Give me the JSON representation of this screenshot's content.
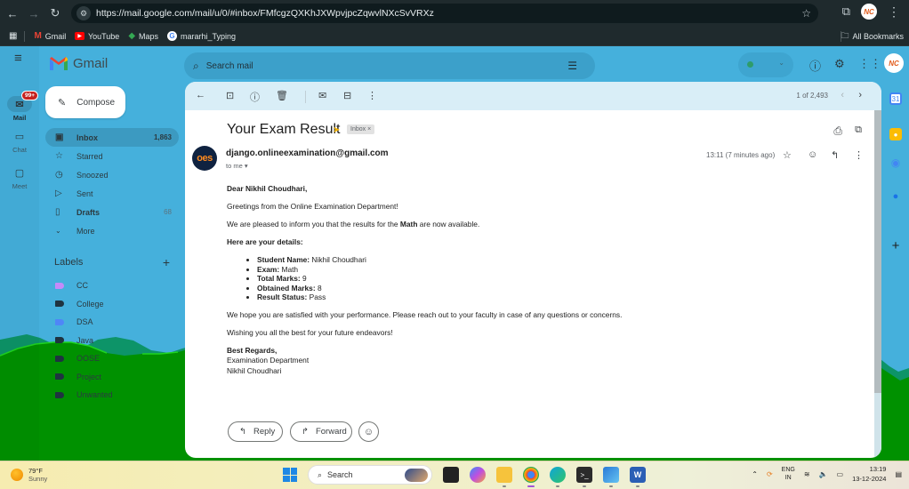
{
  "browser": {
    "url": "https://mail.google.com/mail/u/0/#inbox/FMfcgzQXKhJXWpvjpcZqwvlNXcSvVRXz",
    "bookmarks": [
      {
        "label": "Gmail",
        "icon": "gmail-icon"
      },
      {
        "label": "YouTube",
        "icon": "youtube-icon"
      },
      {
        "label": "Maps",
        "icon": "maps-icon"
      },
      {
        "label": "mararhi_Typing",
        "icon": "google-icon"
      }
    ],
    "all_bookmarks": "All Bookmarks",
    "profile_initials": "NC"
  },
  "gmail": {
    "app_name": "Gmail",
    "rail": [
      {
        "label": "Mail",
        "badge": "99+",
        "active": true
      },
      {
        "label": "Chat"
      },
      {
        "label": "Meet"
      }
    ],
    "compose": "Compose",
    "folders": [
      {
        "label": "Inbox",
        "count": "1,863",
        "icon": "inbox-icon",
        "active": true
      },
      {
        "label": "Starred",
        "count": "",
        "icon": "star-icon"
      },
      {
        "label": "Snoozed",
        "count": "",
        "icon": "clock-icon"
      },
      {
        "label": "Sent",
        "count": "",
        "icon": "send-icon"
      },
      {
        "label": "Drafts",
        "count": "68",
        "icon": "draft-icon"
      },
      {
        "label": "More",
        "count": "",
        "icon": "chevron-down-icon"
      }
    ],
    "labels_title": "Labels",
    "labels": [
      {
        "name": "CC",
        "color": "#c58af9"
      },
      {
        "name": "College",
        "color": "#1f3340"
      },
      {
        "name": "DSA",
        "color": "#4f86f7"
      },
      {
        "name": "Java",
        "color": "#1f3340"
      },
      {
        "name": "OOSE",
        "color": "#1f3340"
      },
      {
        "name": "Project",
        "color": "#1f3340"
      },
      {
        "name": "Unwanted",
        "color": "#1f3340"
      }
    ],
    "search_placeholder": "Search mail",
    "pager": "1 of 2,493"
  },
  "email": {
    "subject": "Your Exam Result",
    "chip": "Inbox ×",
    "sender": "django.onlineexamination@gmail.com",
    "avatar_text": "oes",
    "to": "to me ▾",
    "time": "13:11 (7 minutes ago)",
    "greeting": "Dear Nikhil Choudhari,",
    "p1": "Greetings from the Online Examination Department!",
    "p2_pre": "We are pleased to inform you that the results for the ",
    "p2_bold": "Math",
    "p2_post": " are now available.",
    "details_heading": "Here are your details:",
    "details": [
      {
        "key": "Student Name:",
        "value": " Nikhil Choudhari"
      },
      {
        "key": "Exam:",
        "value": " Math"
      },
      {
        "key": "Total Marks:",
        "value": " 9"
      },
      {
        "key": "Obtained Marks:",
        "value": " 8"
      },
      {
        "key": "Result Status:",
        "value": " Pass"
      }
    ],
    "p3": "We hope you are satisfied with your performance. Please reach out to your faculty in case of any questions or concerns.",
    "p4": "Wishing you all the best for your future endeavors!",
    "sign_off": "Best Regards,",
    "sig_line1": "Examination Department",
    "sig_line2": "Nikhil Choudhari",
    "reply": "Reply",
    "forward": "Forward"
  },
  "taskbar": {
    "temp": "79°F",
    "weather": "Sunny",
    "search": "Search",
    "lang1": "ENG",
    "lang2": "IN",
    "time": "13:19",
    "date": "13-12-2024"
  }
}
